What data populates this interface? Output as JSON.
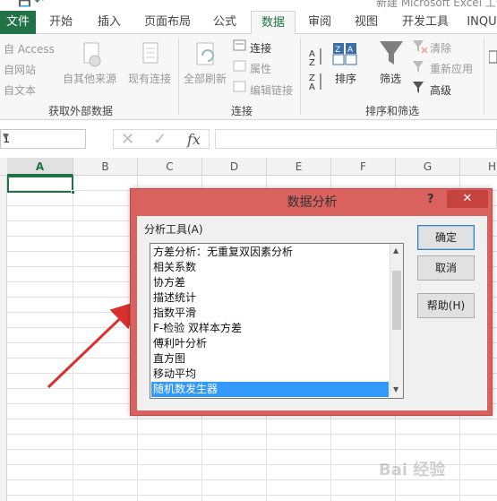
{
  "window": {
    "title": "新建 Microsoft Excel 工作表",
    "quick_access": "💾 ↶"
  },
  "ribbon": {
    "tabs": [
      {
        "label": "文件"
      },
      {
        "label": "开始"
      },
      {
        "label": "插入"
      },
      {
        "label": "页面布局"
      },
      {
        "label": "公式"
      },
      {
        "label": "数据"
      },
      {
        "label": "审阅"
      },
      {
        "label": "视图"
      },
      {
        "label": "开发工具"
      },
      {
        "label": "INQU"
      }
    ],
    "external_data": {
      "access": "自 Access",
      "web": "自网站",
      "text": "自文本",
      "other_sources": "自其他来源",
      "existing": "现有连接",
      "group_label": "获取外部数据"
    },
    "connections": {
      "refresh_all": "全部刷新",
      "connections": "连接",
      "properties": "属性",
      "edit_links": "编辑链接",
      "group_label": "连接"
    },
    "sort_filter": {
      "sort": "排序",
      "filter": "筛选",
      "clear": "清除",
      "reapply": "重新应用",
      "advanced": "高级",
      "group_label": "排序和筛选"
    }
  },
  "formula_bar": {
    "name_box": "1",
    "fx": "fx"
  },
  "grid": {
    "columns": [
      "A",
      "B",
      "C",
      "D",
      "E",
      "F",
      "G",
      "H"
    ],
    "selected_column": "A"
  },
  "dialog": {
    "title": "数据分析",
    "help_glyph": "?",
    "close_glyph": "✕",
    "tools_label": "分析工具(A)",
    "items": [
      "方差分析：无重复双因素分析",
      "相关系数",
      "协方差",
      "描述统计",
      "指数平滑",
      "F-检验 双样本方差",
      "傅利叶分析",
      "直方图",
      "移动平均",
      "随机数发生器"
    ],
    "selected_item": "随机数发生器",
    "buttons": {
      "ok": "确定",
      "cancel": "取消",
      "help": "帮助(H)"
    }
  },
  "annotation": {
    "arrow_color": "#d9302f"
  },
  "watermark": "Bai 经验"
}
